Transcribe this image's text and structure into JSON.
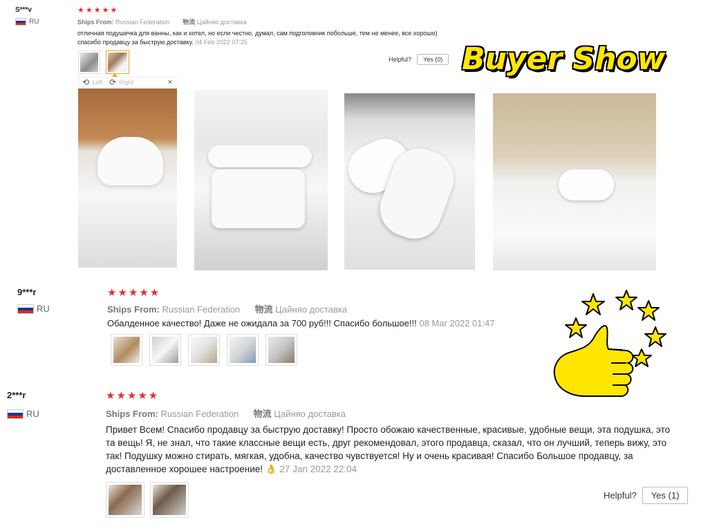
{
  "reviews": [
    {
      "user": "S***v",
      "country": "RU",
      "stars": "★★★★★",
      "ships_from_label": "Ships From:",
      "ships_from_value": "Russian Federation",
      "logistics_label": "物流",
      "logistics_value": "Цайняо доставка",
      "text": "отличная подушечка для ванны, как и хотел, но если честно, думал, сам подголовник побольше, тем не менее, все хорошо) спасибо продавцу за быструю доставку.",
      "date": "04 Feb 2022 07:25",
      "helpful_label": "Helpful?",
      "yes_label": "Yes (0)"
    },
    {
      "user": "9***r",
      "country": "RU",
      "stars": "★★★★★",
      "ships_from_label": "Ships From:",
      "ships_from_value": "Russian Federation",
      "logistics_label": "物流",
      "logistics_value": "Цайняо доставка",
      "text": "Обалденное качество! Даже не ожидала за 700 руб!!! Спасибо большое!!!",
      "date": "08 Mar 2022 01:47"
    },
    {
      "user": "2***r",
      "country": "RU",
      "stars": "★★★★★",
      "ships_from_label": "Ships From:",
      "ships_from_value": "Russian Federation",
      "logistics_label": "物流",
      "logistics_value": "Цайняо доставка",
      "text": "Привет Всем! Спасибо продавцу за быструю доставку! Просто обожаю качественные, красивые, удобные вещи, эта подушка, это та вещь! Я, не знал, что такие классные вещи есть, друг рекомендовал, этого продавца, сказал, что он лучший, теперь вижу, это так! Подушку можно стирать, мягкая, удобна, качество чувствуется! Ну и очень красивая! Спасибо Большое продавцу, за доставленное хорошее настроение! 👌",
      "date": "27 Jan 2022 22:04",
      "helpful_label": "Helpful?",
      "yes_label": "Yes (1)"
    }
  ],
  "viewer": {
    "left_label": "Left",
    "right_label": "Right",
    "close": "×"
  },
  "banner": {
    "buyer_show": "Buyer Show"
  },
  "colors": {
    "star": "#e62e2e",
    "banner": "#ffe600",
    "thumb_selected": "#e8a22c"
  }
}
